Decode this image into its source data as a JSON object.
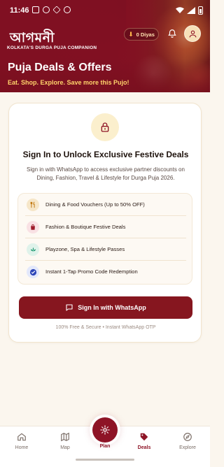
{
  "status_bar": {
    "time": "11:46"
  },
  "header": {
    "logo_text": "আগমনী",
    "tagline": "KOLKATA'S DURGA PUJA COMPANION",
    "diyas": "0 Diyas",
    "title": "Puja Deals & Offers",
    "subtitle": "Eat. Shop. Explore. Save more this Pujo!"
  },
  "card": {
    "title": "Sign In to Unlock Exclusive Festive Deals",
    "description": "Sign in with WhatsApp to access exclusive partner discounts on Dining, Fashion, Travel & Lifestyle for Durga Puja 2026.",
    "benefits": [
      {
        "label": "Dining & Food Vouchers (Up to 50% OFF)",
        "icon": "fork-knife-icon",
        "color": "#f6e6c8"
      },
      {
        "label": "Fashion & Boutique Festive Deals",
        "icon": "shopping-bag-icon",
        "color": "#f9e1e4"
      },
      {
        "label": "Playzone, Spa & Lifestyle Passes",
        "icon": "lotus-icon",
        "color": "#dff2ea"
      },
      {
        "label": "Instant 1-Tap Promo Code Redemption",
        "icon": "check-badge-icon",
        "color": "#e3e8fb"
      }
    ],
    "button_label": "Sign In with WhatsApp",
    "secure_note": "100% Free & Secure • Instant WhatsApp OTP"
  },
  "bottom_nav": {
    "items": [
      {
        "label": "Home",
        "icon": "home-icon"
      },
      {
        "label": "Map",
        "icon": "map-icon"
      },
      {
        "label": "Plan",
        "icon": "plan-icon"
      },
      {
        "label": "Deals",
        "icon": "tag-icon",
        "active": true
      },
      {
        "label": "Explore",
        "icon": "compass-icon"
      }
    ]
  },
  "colors": {
    "brand": "#8e1426",
    "accent": "#ffd36b",
    "background": "#fbf6ee"
  }
}
